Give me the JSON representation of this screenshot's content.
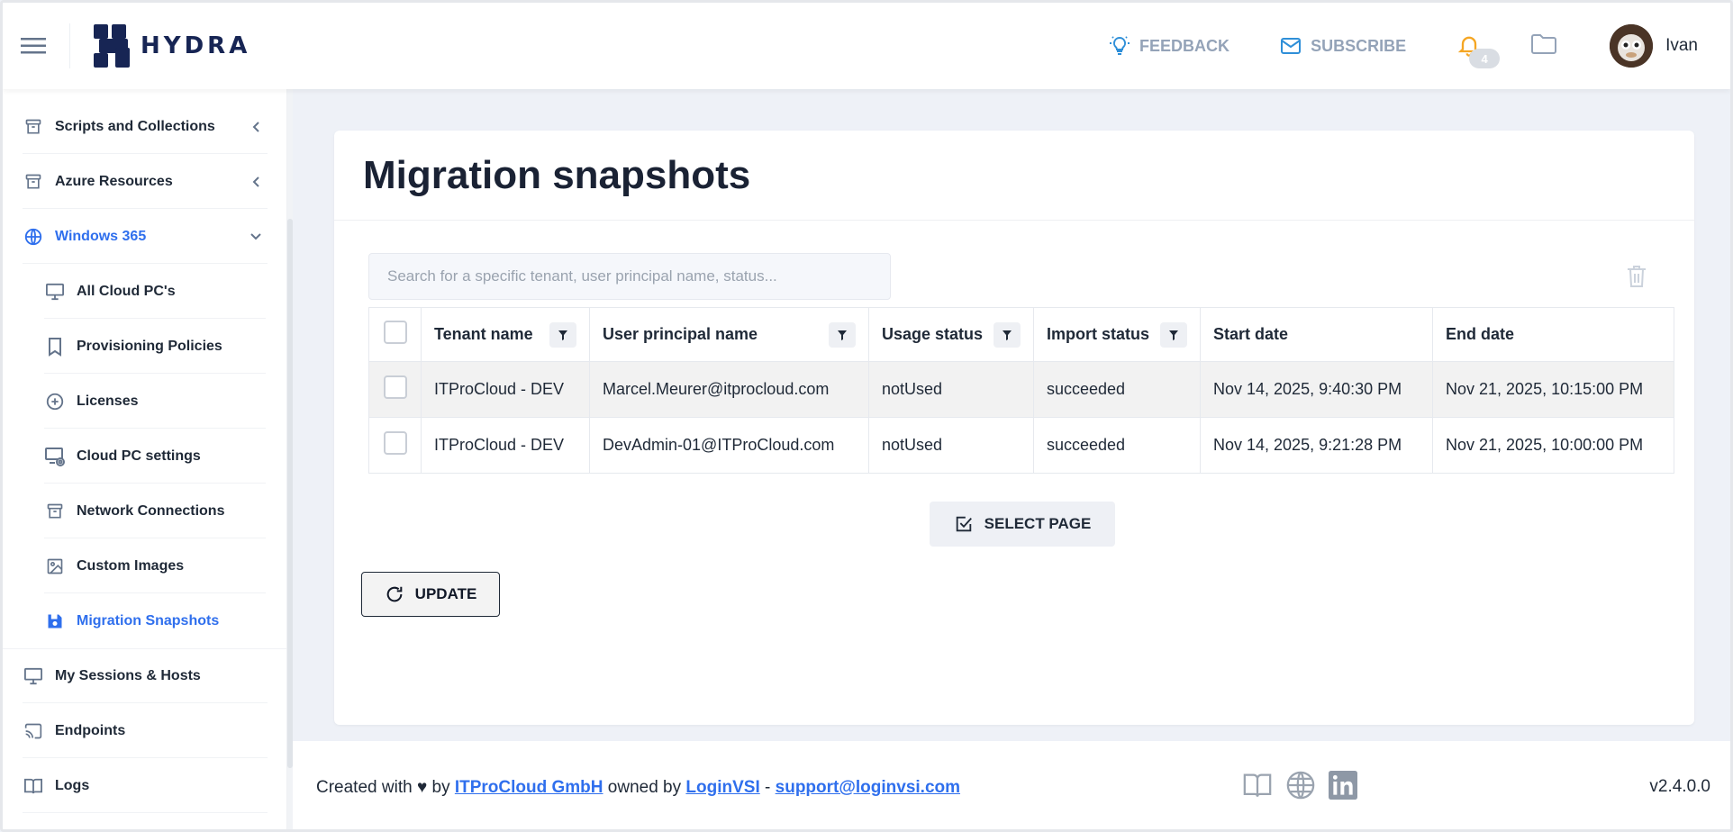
{
  "header": {
    "logo_text": "HYDRA",
    "feedback_label": "FEEDBACK",
    "subscribe_label": "SUBSCRIBE",
    "notification_count": "4",
    "user_name": "Ivan",
    "accent_color": "#2f6fed"
  },
  "sidebar": {
    "items": [
      {
        "label": "Scripts and Collections",
        "icon": "archive-icon"
      },
      {
        "label": "Azure Resources",
        "icon": "archive-icon"
      },
      {
        "label": "Windows 365",
        "icon": "globe-icon"
      },
      {
        "label": "All Cloud PC's",
        "icon": "monitor-icon"
      },
      {
        "label": "Provisioning Policies",
        "icon": "bookmark-icon"
      },
      {
        "label": "Licenses",
        "icon": "plus-circle-icon"
      },
      {
        "label": "Cloud PC settings",
        "icon": "monitor-settings-icon"
      },
      {
        "label": "Network Connections",
        "icon": "archive-icon"
      },
      {
        "label": "Custom Images",
        "icon": "image-icon"
      },
      {
        "label": "Migration Snapshots",
        "icon": "save-icon"
      },
      {
        "label": "My Sessions & Hosts",
        "icon": "monitor-icon"
      },
      {
        "label": "Endpoints",
        "icon": "cast-icon"
      },
      {
        "label": "Logs",
        "icon": "book-icon"
      }
    ]
  },
  "main": {
    "title": "Migration snapshots",
    "search_placeholder": "Search for a specific tenant, user principal name, status...",
    "columns": [
      "Tenant name",
      "User principal name",
      "Usage status",
      "Import status",
      "Start date",
      "End date"
    ],
    "rows": [
      {
        "tenant": "ITProCloud - DEV",
        "upn": "Marcel.Meurer@itprocloud.com",
        "usage": "notUsed",
        "import": "succeeded",
        "start": "Nov 14, 2025, 9:40:30 PM",
        "end": "Nov 21, 2025, 10:15:00 PM"
      },
      {
        "tenant": "ITProCloud - DEV",
        "upn": "DevAdmin-01@ITProCloud.com",
        "usage": "notUsed",
        "import": "succeeded",
        "start": "Nov 14, 2025, 9:21:28 PM",
        "end": "Nov 21, 2025, 10:00:00 PM"
      }
    ],
    "select_page_label": "SELECT PAGE",
    "update_label": "UPDATE"
  },
  "footer": {
    "created_with": "Created with ♥ by ",
    "company": "ITProCloud GmbH",
    "owned_by": " owned by ",
    "owner": "LoginVSI",
    "dash": " - ",
    "email": "support@loginvsi.com",
    "version": "v2.4.0.0"
  }
}
